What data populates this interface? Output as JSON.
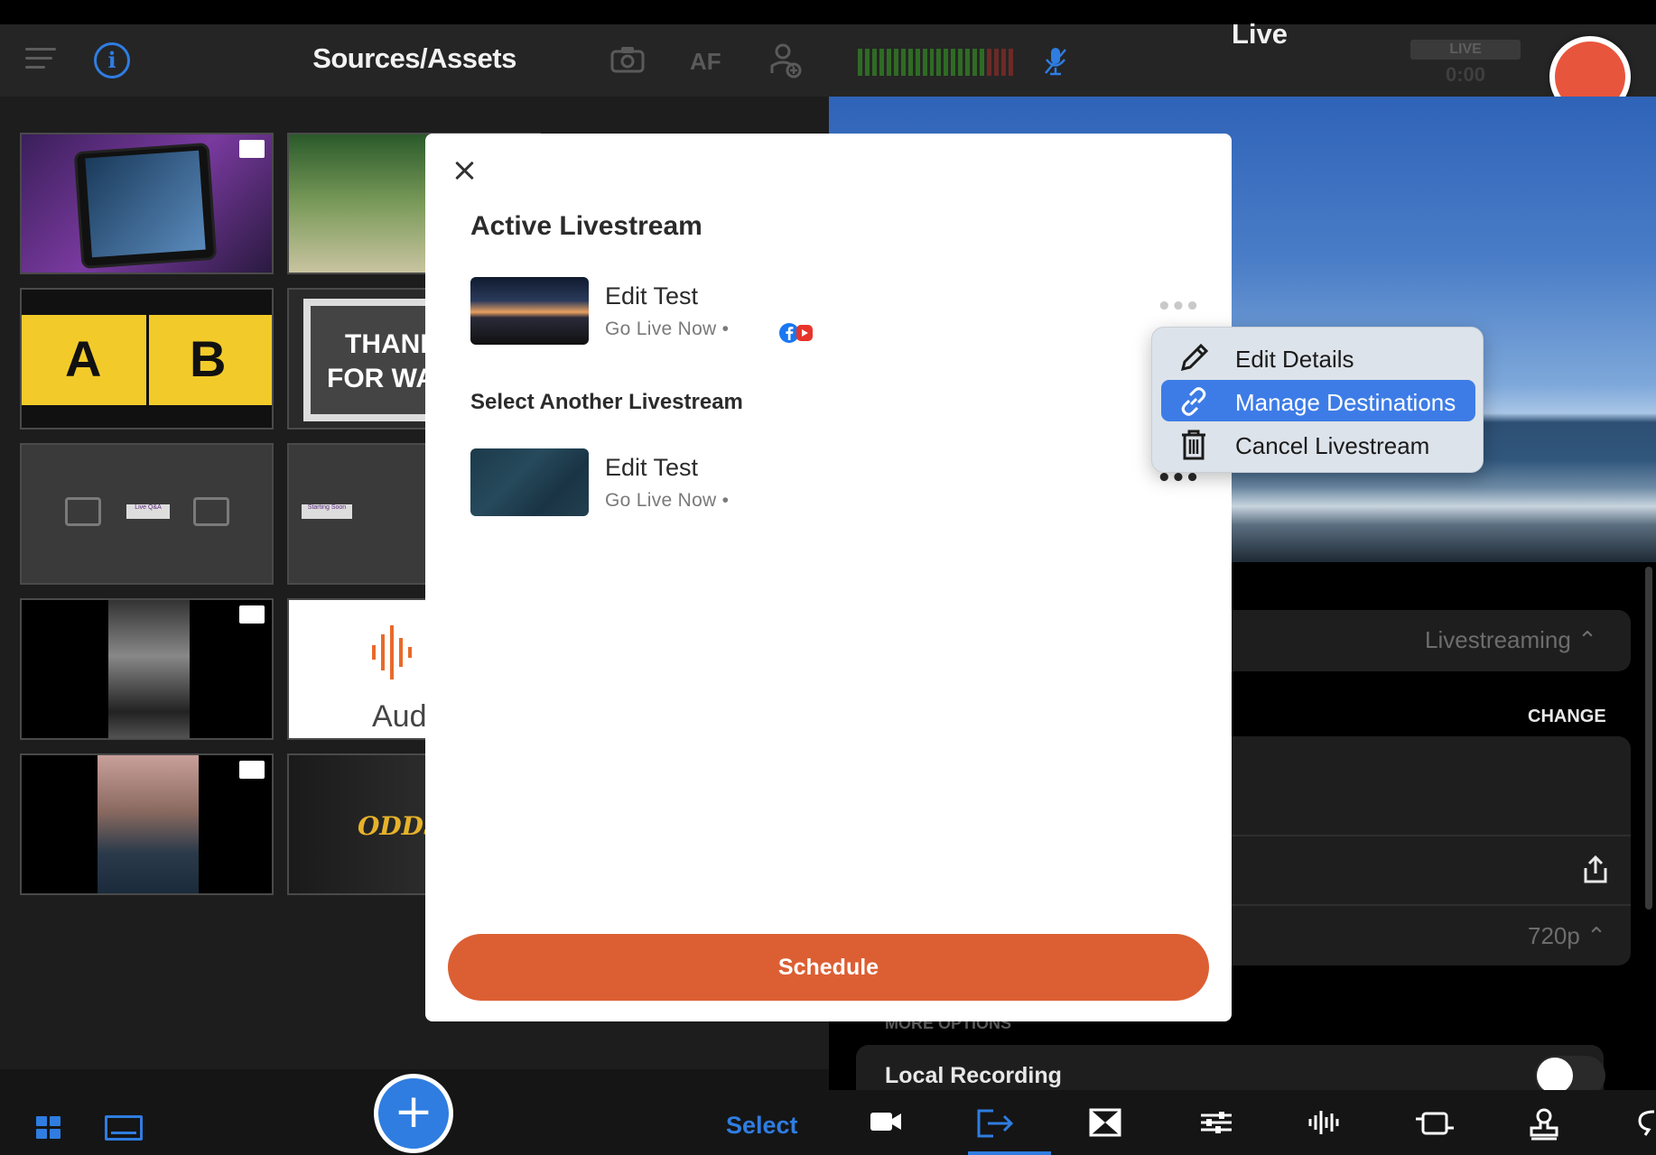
{
  "left_panel": {
    "title": "Sources/Assets",
    "af_label": "AF",
    "footer": {
      "select_label": "Select",
      "add_label": "+"
    },
    "tiles": {
      "ab_left": "A",
      "ab_right": "B",
      "thank": "THANK",
      "for_wat": "FOR WAT",
      "live_qa": "Live Q&A",
      "starting_soon": "Starting Soon",
      "aud": "Aud",
      "odds": "ODDS"
    }
  },
  "right_panel": {
    "title": "Live",
    "live_badge": "LIVE",
    "live_time": "0:00",
    "mode_value": "Livestreaming ⌃",
    "change_label": "CHANGE",
    "resolution_value": "720p ⌃",
    "more_options": "MORE OPTIONS",
    "local_recording": "Local Recording"
  },
  "modal": {
    "active_heading": "Active Livestream",
    "active_stream": {
      "title": "Edit Test",
      "subtitle": "Go Live Now •"
    },
    "another_heading": "Select Another Livestream",
    "other_stream": {
      "title": "Edit Test",
      "subtitle": "Go Live Now •"
    },
    "more_dots": "•••",
    "schedule_label": "Schedule"
  },
  "context_menu": {
    "items": [
      {
        "label": "Edit Details",
        "icon": "pencil-icon"
      },
      {
        "label": "Manage Destinations",
        "icon": "link-icon",
        "selected": true
      },
      {
        "label": "Cancel Livestream",
        "icon": "trash-icon"
      }
    ]
  },
  "colors": {
    "accent_blue": "#2f7de1",
    "record_red": "#e8553d",
    "schedule_orange": "#dc5f33",
    "menu_selected": "#3d7ce7"
  }
}
